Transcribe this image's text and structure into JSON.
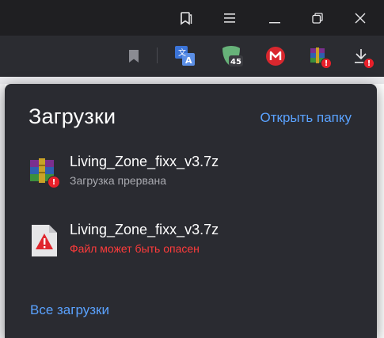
{
  "titlebar": {
    "icons": [
      "collections-icon",
      "menu-icon",
      "minimize-icon",
      "restore-icon",
      "close-icon"
    ]
  },
  "toolbar": {
    "extensions": [
      {
        "name": "bookmark-icon"
      },
      {
        "name": "translate-extension-icon"
      },
      {
        "name": "adguard-extension-icon",
        "badge": "45"
      },
      {
        "name": "mega-extension-icon"
      },
      {
        "name": "winrar-download-icon"
      },
      {
        "name": "downloads-icon"
      }
    ]
  },
  "downloads_panel": {
    "title": "Загрузки",
    "open_folder": "Открыть папку",
    "items": [
      {
        "filename": "Living_Zone_fixx_v3.7z",
        "status": "Загрузка прервана",
        "status_color": "#a9aab0",
        "icon": "winrar-archive-icon"
      },
      {
        "filename": "Living_Zone_fixx_v3.7z",
        "status": "Файл может быть опасен",
        "status_color": "#ff3b3b",
        "icon": "warning-file-icon"
      }
    ],
    "all_downloads": "Все загрузки"
  },
  "colors": {
    "panel_bg": "#2a2b31",
    "link": "#5aa2ff",
    "danger": "#ff3b3b",
    "badge": "#e8202a"
  }
}
